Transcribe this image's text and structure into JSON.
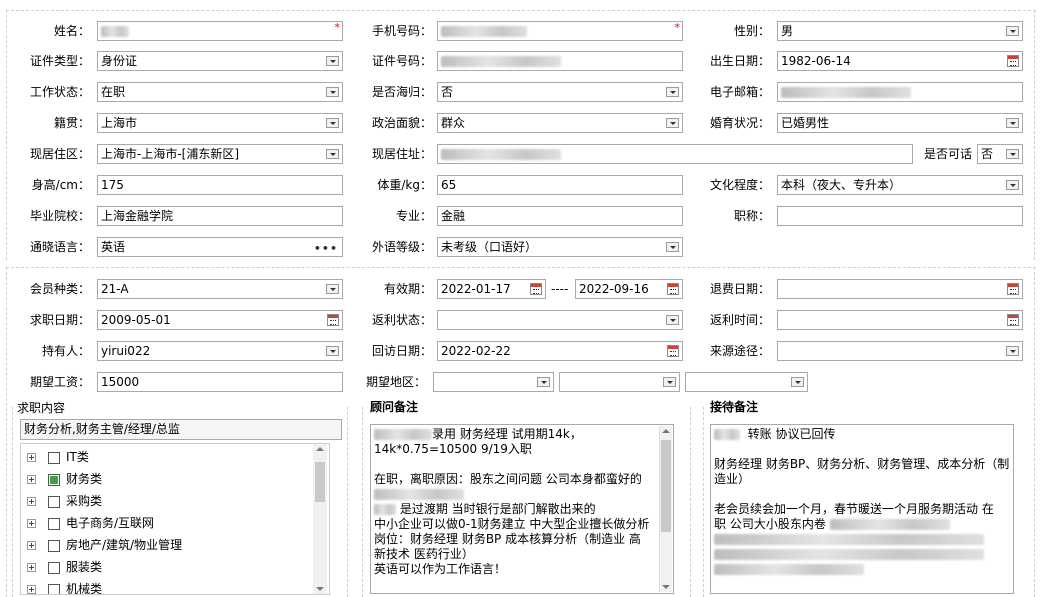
{
  "row1": {
    "name_label": "姓名：",
    "phone_label": "手机号码：",
    "gender_label": "性别：",
    "gender_value": "男"
  },
  "row2": {
    "idtype_label": "证件类型：",
    "idtype_value": "身份证",
    "idno_label": "证件号码：",
    "birth_label": "出生日期：",
    "birth_value": "1982-06-14"
  },
  "row3": {
    "work_label": "工作状态：",
    "work_value": "在职",
    "overseas_label": "是否海归：",
    "overseas_value": "否",
    "email_label": "电子邮箱："
  },
  "row4": {
    "native_label": "籍贯：",
    "native_value": "上海市",
    "political_label": "政治面貌：",
    "political_value": "群众",
    "marital_label": "婚育状况：",
    "marital_value": "已婚男性"
  },
  "row5": {
    "resarea_label": "现居住区：",
    "resarea_value": "上海市-上海市-[浦东新区]",
    "resaddr_label": "现居住址：",
    "visible_label": "是否可话",
    "visible_value": "否"
  },
  "row6": {
    "height_label": "身高/cm：",
    "height_value": "175",
    "weight_label": "体重/kg：",
    "weight_value": "65",
    "edu_label": "文化程度：",
    "edu_value": "本科（夜大、专升本）"
  },
  "row7": {
    "school_label": "毕业院校：",
    "school_value": "上海金融学院",
    "major_label": "专业：",
    "major_value": "金融",
    "title_label": "职称："
  },
  "row8": {
    "lang_label": "通晓语言：",
    "lang_value": "英语",
    "foreign_label": "外语等级：",
    "foreign_value": "未考级（口语好）"
  },
  "row9": {
    "member_label": "会员种类：",
    "member_value": "21-A",
    "valid_label": "有效期：",
    "valid_from": "2022-01-17",
    "valid_sep": "----",
    "valid_to": "2022-09-16",
    "refund_label": "退费日期："
  },
  "row10": {
    "jobdate_label": "求职日期：",
    "jobdate_value": "2009-05-01",
    "rebate_status_label": "返利状态：",
    "rebate_time_label": "返利时间："
  },
  "row11": {
    "holder_label": "持有人：",
    "holder_value": "yirui022",
    "visit_label": "回访日期：",
    "visit_value": "2022-02-22",
    "source_label": "来源途径："
  },
  "row12": {
    "salary_label": "期望工资：",
    "salary_value": "15000",
    "region_label": "期望地区："
  },
  "jobs": {
    "title": "求职内容",
    "selected": "财务分析,财务主管/经理/总监",
    "items": [
      {
        "label": "IT类",
        "checked": false
      },
      {
        "label": "财务类",
        "checked": true
      },
      {
        "label": "采购类",
        "checked": false
      },
      {
        "label": "电子商务/互联网",
        "checked": false
      },
      {
        "label": "房地产/建筑/物业管理",
        "checked": false
      },
      {
        "label": "服装类",
        "checked": false
      },
      {
        "label": "机械类",
        "checked": false
      }
    ]
  },
  "advisor": {
    "title": "顾问备注",
    "lines": [
      "录用 财务经理 试用期14k，",
      "14k*0.75=10500  9/19入职",
      "",
      "在职，离职原因：股东之间问题  公司本身都蛮好的",
      "",
      "是过渡期 当时银行是部门解散出来的",
      "中小企业可以做0-1财务建立 中大型企业擅长做分析",
      "岗位：财务经理 财务BP 成本核算分析（制造业 高",
      "新技术 医药行业）",
      "英语可以作为工作语言！"
    ]
  },
  "reception": {
    "title": "接待备注",
    "lines": [
      "转账 协议已回传",
      "",
      "财务经理 财务BP、财务分析、财务管理、成本分析（制",
      "造业）",
      "",
      "老会员续会加一个月，春节暖送一个月服务期活动  在",
      "职  公司大小股东内卷"
    ]
  }
}
